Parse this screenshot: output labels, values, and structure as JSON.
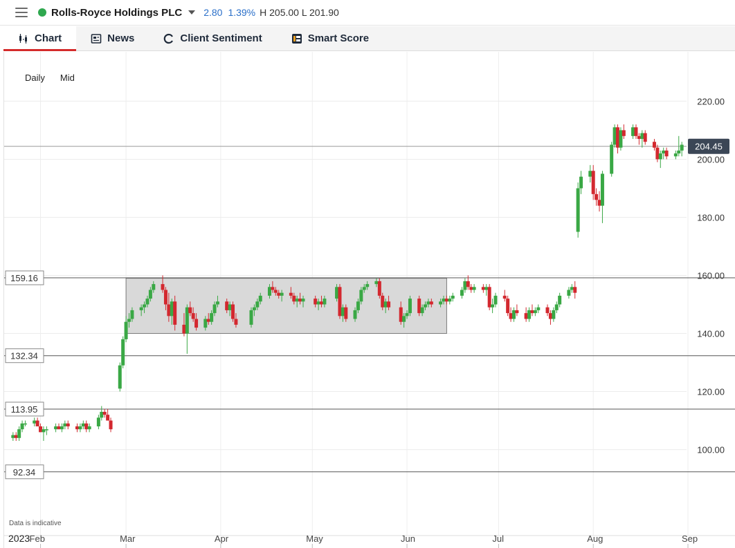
{
  "header": {
    "instrument": "Rolls-Royce Holdings PLC",
    "change": "2.80",
    "change_pct": "1.39%",
    "high_low": "H 205.00  L 201.90",
    "status_color": "#2fa84f",
    "change_color": "#2a6fc9"
  },
  "tabs": [
    {
      "label": "Chart",
      "icon": "candlestick-icon",
      "active": true
    },
    {
      "label": "News",
      "icon": "newspaper-icon",
      "active": false
    },
    {
      "label": "Client Sentiment",
      "icon": "sentiment-icon",
      "active": false
    },
    {
      "label": "Smart Score",
      "icon": "smart-score-icon",
      "active": false
    }
  ],
  "chart_options": {
    "interval": "Daily",
    "price_type": "Mid"
  },
  "disclaimer": "Data is indicative",
  "chart_data": {
    "type": "candlestick",
    "y_axis": {
      "min": 88,
      "max": 232,
      "ticks": [
        "100.00",
        "120.00",
        "140.00",
        "160.00",
        "180.00",
        "200.00",
        "220.00"
      ],
      "position": "right"
    },
    "x_axis": {
      "year_label": "2023",
      "month_labels": [
        "Feb",
        "Mar",
        "Apr",
        "May",
        "Jun",
        "Jul",
        "Aug",
        "Sep"
      ]
    },
    "current_price": {
      "value": 204.45,
      "label": "204.45"
    },
    "levels": [
      {
        "value": 159.16,
        "label": "159.16"
      },
      {
        "value": 132.34,
        "label": "132.34"
      },
      {
        "value": 113.95,
        "label": "113.95"
      },
      {
        "value": 92.34,
        "label": "92.34"
      }
    ],
    "range_box": {
      "from": "2023-03-01",
      "to": "2023-06-14",
      "low": 140,
      "high": 159
    },
    "up_color": "#3aa845",
    "down_color": "#d3282f",
    "candles": [
      [
        "2023-01-23",
        104,
        106,
        103,
        105
      ],
      [
        "2023-01-24",
        105,
        106,
        103,
        104
      ],
      [
        "2023-01-25",
        104,
        108,
        103,
        107
      ],
      [
        "2023-01-26",
        107,
        110,
        106,
        109
      ],
      [
        "2023-01-27",
        109,
        110,
        108,
        109
      ],
      [
        "2023-01-30",
        109,
        111,
        108,
        110
      ],
      [
        "2023-01-31",
        110,
        111,
        108,
        108
      ],
      [
        "2023-02-01",
        108,
        109,
        106,
        106
      ],
      [
        "2023-02-02",
        106,
        108,
        103,
        107
      ],
      [
        "2023-02-03",
        107,
        108,
        105,
        107
      ],
      [
        "2023-02-06",
        107,
        109,
        106,
        108
      ],
      [
        "2023-02-07",
        108,
        109,
        107,
        107
      ],
      [
        "2023-02-08",
        107,
        109,
        106,
        108
      ],
      [
        "2023-02-09",
        108,
        110,
        107,
        109
      ],
      [
        "2023-02-10",
        109,
        110,
        107,
        108
      ],
      [
        "2023-02-13",
        108,
        109,
        106,
        107
      ],
      [
        "2023-02-14",
        107,
        109,
        106,
        108
      ],
      [
        "2023-02-15",
        108,
        110,
        107,
        109
      ],
      [
        "2023-02-16",
        109,
        110,
        106,
        107
      ],
      [
        "2023-02-17",
        107,
        109,
        106,
        108
      ],
      [
        "2023-02-20",
        108,
        112,
        107,
        111
      ],
      [
        "2023-02-21",
        111,
        115,
        110,
        113
      ],
      [
        "2023-02-22",
        113,
        114,
        111,
        112
      ],
      [
        "2023-02-23",
        112,
        114,
        110,
        110
      ],
      [
        "2023-02-24",
        110,
        111,
        106,
        107
      ],
      [
        "2023-02-27",
        121,
        130,
        120,
        129
      ],
      [
        "2023-02-28",
        129,
        139,
        128,
        138
      ],
      [
        "2023-03-01",
        138,
        146,
        137,
        144
      ],
      [
        "2023-03-02",
        144,
        147,
        142,
        145
      ],
      [
        "2023-03-03",
        145,
        149,
        144,
        148
      ],
      [
        "2023-03-06",
        148,
        150,
        146,
        149
      ],
      [
        "2023-03-07",
        149,
        151,
        147,
        150
      ],
      [
        "2023-03-08",
        150,
        153,
        149,
        152
      ],
      [
        "2023-03-09",
        152,
        156,
        151,
        155
      ],
      [
        "2023-03-10",
        155,
        158,
        154,
        157
      ],
      [
        "2023-03-13",
        157,
        160,
        154,
        155
      ],
      [
        "2023-03-14",
        155,
        156,
        148,
        150
      ],
      [
        "2023-03-15",
        150,
        154,
        144,
        146
      ],
      [
        "2023-03-16",
        146,
        152,
        143,
        151
      ],
      [
        "2023-03-17",
        151,
        153,
        141,
        143
      ],
      [
        "2023-03-20",
        143,
        147,
        139,
        140
      ],
      [
        "2023-03-21",
        140,
        150,
        133,
        149
      ],
      [
        "2023-03-22",
        149,
        151,
        146,
        147
      ],
      [
        "2023-03-23",
        147,
        149,
        144,
        145
      ],
      [
        "2023-03-24",
        145,
        147,
        141,
        142
      ],
      [
        "2023-03-27",
        142,
        146,
        141,
        145
      ],
      [
        "2023-03-28",
        145,
        147,
        143,
        144
      ],
      [
        "2023-03-29",
        144,
        148,
        143,
        147
      ],
      [
        "2023-03-30",
        147,
        151,
        146,
        150
      ],
      [
        "2023-03-31",
        150,
        153,
        149,
        151
      ],
      [
        "2023-04-03",
        151,
        152,
        147,
        148
      ],
      [
        "2023-04-04",
        148,
        151,
        146,
        150
      ],
      [
        "2023-04-05",
        150,
        151,
        144,
        145
      ],
      [
        "2023-04-06",
        145,
        147,
        142,
        143
      ],
      [
        "2023-04-11",
        143,
        149,
        142,
        148
      ],
      [
        "2023-04-12",
        148,
        150,
        146,
        149
      ],
      [
        "2023-04-13",
        149,
        152,
        148,
        151
      ],
      [
        "2023-04-14",
        151,
        154,
        150,
        153
      ],
      [
        "2023-04-17",
        153,
        157,
        152,
        156
      ],
      [
        "2023-04-18",
        156,
        158,
        154,
        155
      ],
      [
        "2023-04-19",
        155,
        156,
        153,
        154
      ],
      [
        "2023-04-20",
        154,
        155,
        152,
        153
      ],
      [
        "2023-04-21",
        153,
        155,
        151,
        154
      ],
      [
        "2023-04-24",
        154,
        156,
        152,
        153
      ],
      [
        "2023-04-25",
        153,
        154,
        150,
        151
      ],
      [
        "2023-04-26",
        151,
        153,
        149,
        152
      ],
      [
        "2023-04-27",
        152,
        154,
        150,
        151
      ],
      [
        "2023-04-28",
        151,
        153,
        149,
        152
      ],
      [
        "2023-05-02",
        152,
        153,
        149,
        150
      ],
      [
        "2023-05-03",
        150,
        152,
        148,
        151
      ],
      [
        "2023-05-04",
        151,
        153,
        149,
        150
      ],
      [
        "2023-05-05",
        150,
        153,
        149,
        152
      ],
      [
        "2023-05-09",
        152,
        157,
        151,
        156
      ],
      [
        "2023-05-10",
        156,
        157,
        145,
        146
      ],
      [
        "2023-05-11",
        146,
        150,
        144,
        149
      ],
      [
        "2023-05-12",
        149,
        150,
        144,
        145
      ],
      [
        "2023-05-15",
        145,
        149,
        144,
        148
      ],
      [
        "2023-05-16",
        148,
        152,
        147,
        151
      ],
      [
        "2023-05-17",
        151,
        156,
        150,
        155
      ],
      [
        "2023-05-18",
        155,
        157,
        154,
        156
      ],
      [
        "2023-05-19",
        156,
        158,
        155,
        157
      ],
      [
        "2023-05-22",
        157,
        159,
        156,
        158
      ],
      [
        "2023-05-23",
        158,
        159,
        152,
        153
      ],
      [
        "2023-05-24",
        153,
        154,
        148,
        149
      ],
      [
        "2023-05-25",
        149,
        152,
        147,
        151
      ],
      [
        "2023-05-26",
        151,
        153,
        148,
        149
      ],
      [
        "2023-05-30",
        149,
        151,
        143,
        144
      ],
      [
        "2023-05-31",
        144,
        147,
        142,
        146
      ],
      [
        "2023-06-01",
        146,
        148,
        145,
        147
      ],
      [
        "2023-06-02",
        147,
        153,
        146,
        152
      ],
      [
        "2023-06-05",
        152,
        153,
        146,
        147
      ],
      [
        "2023-06-06",
        147,
        150,
        146,
        149
      ],
      [
        "2023-06-07",
        149,
        151,
        148,
        150
      ],
      [
        "2023-06-08",
        150,
        152,
        149,
        151
      ],
      [
        "2023-06-09",
        151,
        152,
        149,
        150
      ],
      [
        "2023-06-12",
        150,
        152,
        149,
        151
      ],
      [
        "2023-06-13",
        151,
        153,
        150,
        152
      ],
      [
        "2023-06-14",
        152,
        153,
        150,
        151
      ],
      [
        "2023-06-15",
        151,
        153,
        150,
        152
      ],
      [
        "2023-06-16",
        152,
        154,
        151,
        153
      ],
      [
        "2023-06-19",
        153,
        156,
        152,
        155
      ],
      [
        "2023-06-20",
        155,
        159,
        154,
        158
      ],
      [
        "2023-06-21",
        158,
        160,
        155,
        156
      ],
      [
        "2023-06-22",
        156,
        157,
        154,
        155
      ],
      [
        "2023-06-23",
        155,
        157,
        154,
        156
      ],
      [
        "2023-06-26",
        156,
        157,
        154,
        155
      ],
      [
        "2023-06-27",
        155,
        157,
        153,
        156
      ],
      [
        "2023-06-28",
        156,
        157,
        148,
        149
      ],
      [
        "2023-06-29",
        149,
        152,
        147,
        150
      ],
      [
        "2023-06-30",
        150,
        154,
        149,
        153
      ],
      [
        "2023-07-03",
        153,
        155,
        151,
        152
      ],
      [
        "2023-07-04",
        152,
        153,
        146,
        147
      ],
      [
        "2023-07-05",
        147,
        149,
        144,
        145
      ],
      [
        "2023-07-06",
        145,
        149,
        144,
        148
      ],
      [
        "2023-07-07",
        148,
        150,
        146,
        147
      ],
      [
        "2023-07-10",
        147,
        149,
        144,
        145
      ],
      [
        "2023-07-11",
        145,
        149,
        144,
        148
      ],
      [
        "2023-07-12",
        148,
        150,
        146,
        147
      ],
      [
        "2023-07-13",
        147,
        149,
        146,
        148
      ],
      [
        "2023-07-14",
        148,
        150,
        147,
        149
      ],
      [
        "2023-07-17",
        149,
        150,
        146,
        147
      ],
      [
        "2023-07-18",
        147,
        148,
        143,
        145
      ],
      [
        "2023-07-19",
        145,
        149,
        144,
        148
      ],
      [
        "2023-07-20",
        148,
        151,
        147,
        150
      ],
      [
        "2023-07-21",
        150,
        154,
        149,
        153
      ],
      [
        "2023-07-24",
        153,
        156,
        152,
        155
      ],
      [
        "2023-07-25",
        155,
        157,
        154,
        156
      ],
      [
        "2023-07-26",
        156,
        158,
        152,
        154
      ],
      [
        "2023-07-27",
        175,
        192,
        173,
        190
      ],
      [
        "2023-07-28",
        190,
        196,
        188,
        194
      ],
      [
        "2023-07-31",
        194,
        198,
        192,
        196
      ],
      [
        "2023-08-01",
        196,
        198,
        186,
        188
      ],
      [
        "2023-08-02",
        188,
        190,
        184,
        186
      ],
      [
        "2023-08-03",
        186,
        189,
        182,
        184
      ],
      [
        "2023-08-04",
        184,
        196,
        178,
        195
      ],
      [
        "2023-08-07",
        195,
        206,
        194,
        205
      ],
      [
        "2023-08-08",
        205,
        212,
        204,
        211
      ],
      [
        "2023-08-09",
        211,
        212,
        202,
        204
      ],
      [
        "2023-08-10",
        204,
        211,
        203,
        210
      ],
      [
        "2023-08-11",
        210,
        212,
        207,
        208
      ],
      [
        "2023-08-14",
        208,
        212,
        207,
        211
      ],
      [
        "2023-08-15",
        211,
        212,
        207,
        208
      ],
      [
        "2023-08-16",
        208,
        209,
        205,
        207
      ],
      [
        "2023-08-17",
        207,
        210,
        204,
        209
      ],
      [
        "2023-08-18",
        209,
        210,
        205,
        206
      ],
      [
        "2023-08-21",
        206,
        207,
        203,
        204
      ],
      [
        "2023-08-22",
        204,
        205,
        199,
        200
      ],
      [
        "2023-08-23",
        200,
        203,
        197,
        202
      ],
      [
        "2023-08-24",
        202,
        204,
        200,
        203
      ],
      [
        "2023-08-25",
        203,
        204,
        200,
        201
      ],
      [
        "2023-08-28",
        201,
        203,
        200,
        202
      ],
      [
        "2023-08-29",
        202,
        208,
        201,
        203
      ],
      [
        "2023-08-30",
        203,
        206,
        201,
        205
      ]
    ]
  }
}
